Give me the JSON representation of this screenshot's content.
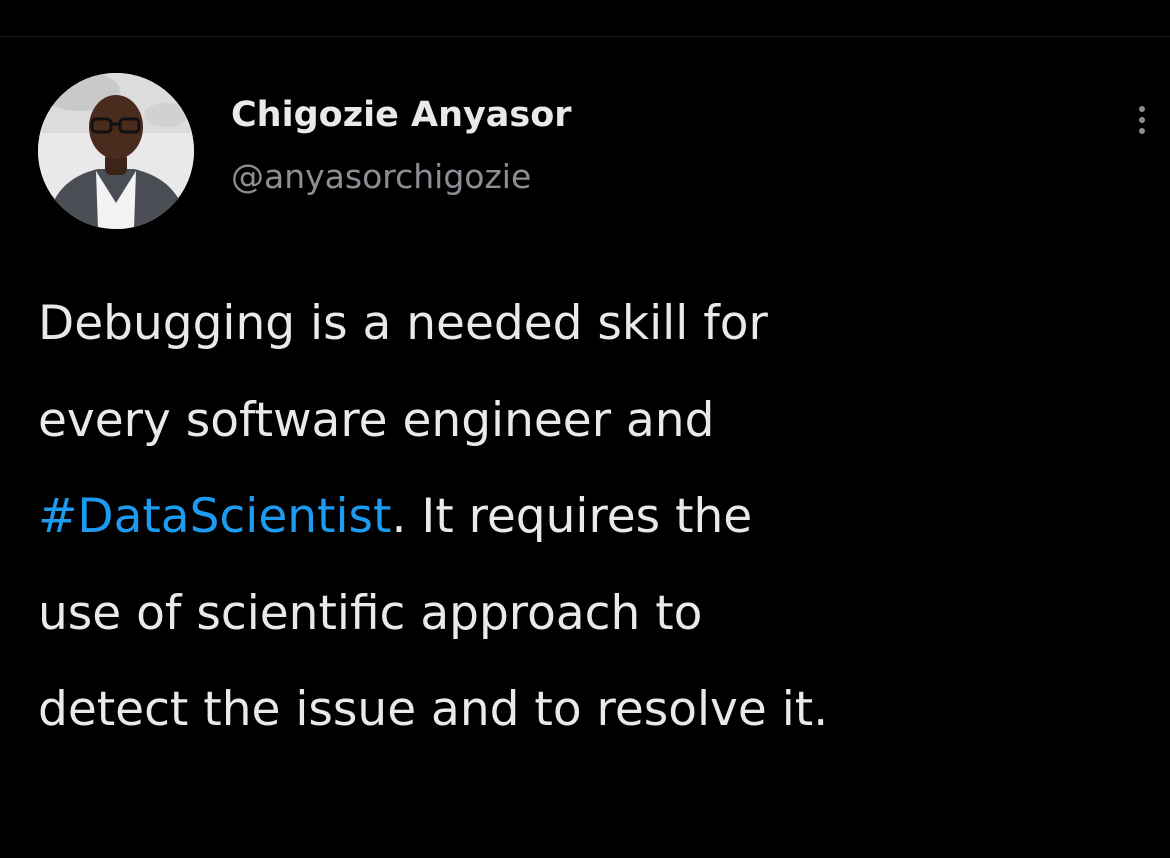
{
  "tweet": {
    "author": {
      "display_name": "Chigozie Anyasor",
      "handle": "@anyasorchigozie",
      "avatar_icon": "profile-photo"
    },
    "more_icon": "more-vertical-icon",
    "text": {
      "line1": "Debugging is a needed skill for",
      "line2": "every software engineer and",
      "hashtag": "#DataScientist",
      "line3_rest": ". It requires the",
      "line4": "use of scientific approach to",
      "line5": "detect the issue and to resolve it."
    }
  },
  "colors": {
    "background": "#000000",
    "text_primary": "#e7e9ea",
    "text_secondary": "#8b8f94",
    "hashtag_accent": "#1d9bf0"
  }
}
